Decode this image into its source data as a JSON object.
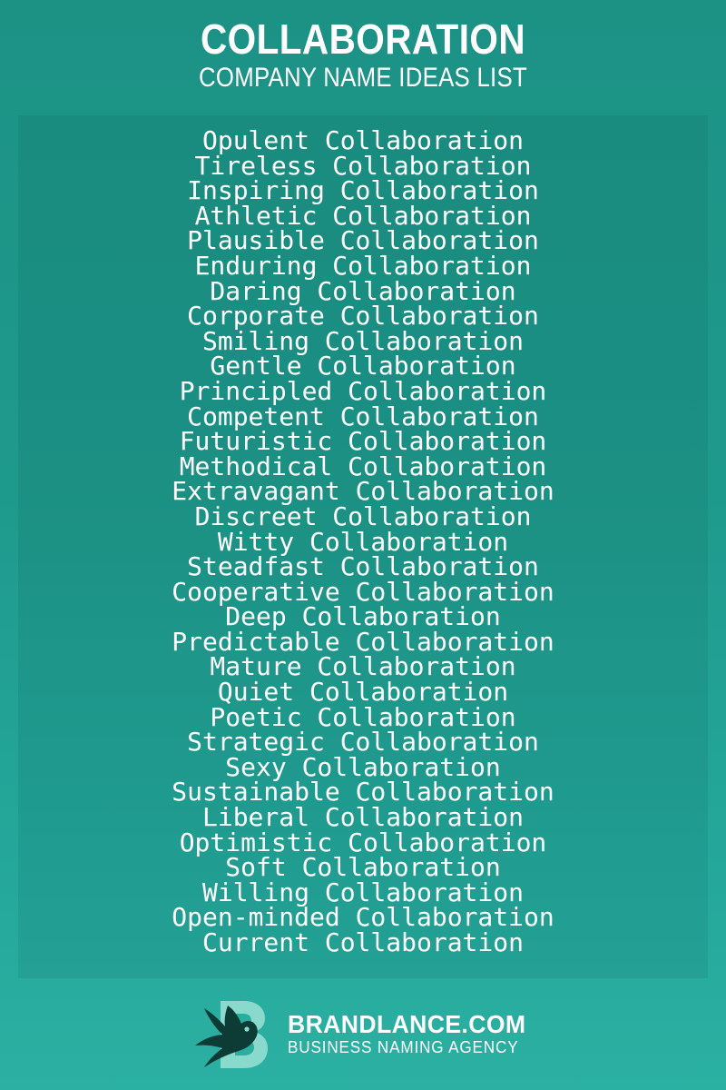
{
  "header": {
    "title": "COLLABORATION",
    "subtitle": "COMPANY NAME IDEAS LIST"
  },
  "colors": {
    "background_top": "#1c9285",
    "background_bottom": "#2bb0a2",
    "card": "#1b8378",
    "text": "#ffffff",
    "logo_bird": "#0d3b36",
    "logo_letter": "#8ad9cd"
  },
  "name_list": {
    "items": [
      "Opulent Collaboration",
      "Tireless Collaboration",
      "Inspiring Collaboration",
      "Athletic Collaboration",
      "Plausible Collaboration",
      "Enduring Collaboration",
      "Daring Collaboration",
      "Corporate Collaboration",
      "Smiling Collaboration",
      "Gentle Collaboration",
      "Principled Collaboration",
      "Competent Collaboration",
      "Futuristic Collaboration",
      "Methodical Collaboration",
      "Extravagant Collaboration",
      "Discreet Collaboration",
      "Witty Collaboration",
      "Steadfast Collaboration",
      "Cooperative Collaboration",
      "Deep Collaboration",
      "Predictable Collaboration",
      "Mature Collaboration",
      "Quiet Collaboration",
      "Poetic Collaboration",
      "Strategic Collaboration",
      "Sexy Collaboration",
      "Sustainable Collaboration",
      "Liberal Collaboration",
      "Optimistic Collaboration",
      "Soft Collaboration",
      "Willing Collaboration",
      "Open-minded Collaboration",
      "Current Collaboration"
    ]
  },
  "footer": {
    "logo_icon": "bird-b-logo-icon",
    "brand_name": "BRANDLANCE.COM",
    "tagline": "BUSINESS NAMING AGENCY"
  }
}
